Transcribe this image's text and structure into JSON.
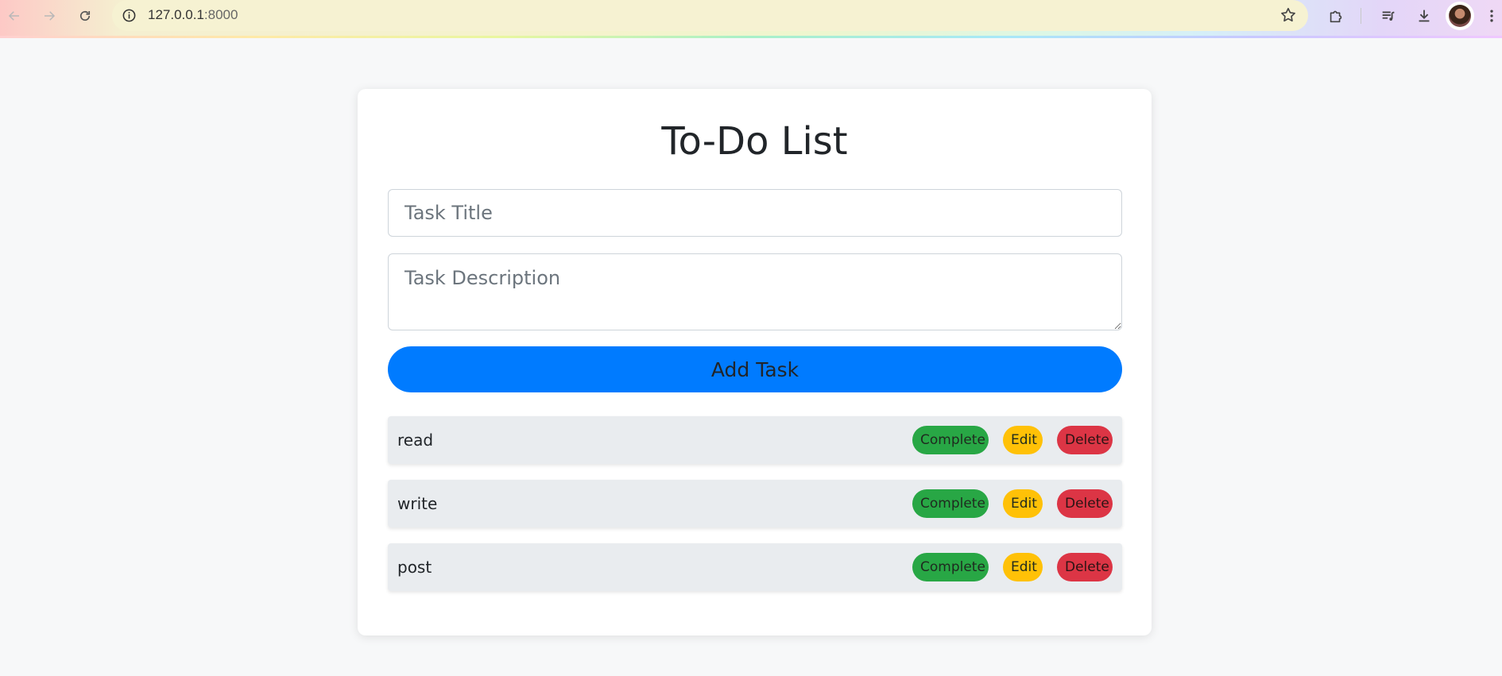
{
  "browser": {
    "url_host": "127.0.0.1",
    "url_port": ":8000"
  },
  "page": {
    "title": "To-Do List",
    "title_placeholder": "Task Title",
    "description_placeholder": "Task Description",
    "add_button_label": "Add Task"
  },
  "tasks": [
    {
      "title": "read",
      "complete_label": "Complete",
      "edit_label": "Edit",
      "delete_label": "Delete"
    },
    {
      "title": "write",
      "complete_label": "Complete",
      "edit_label": "Edit",
      "delete_label": "Delete"
    },
    {
      "title": "post",
      "complete_label": "Complete",
      "edit_label": "Edit",
      "delete_label": "Delete"
    }
  ],
  "colors": {
    "primary": "#007bff",
    "complete": "#28a745",
    "edit": "#ffc107",
    "delete": "#dc3545",
    "task_bg": "#e9ecef",
    "page_bg": "#f7f8f9"
  },
  "icons": {
    "back": "arrow-left-icon",
    "forward": "arrow-right-icon",
    "reload": "reload-icon",
    "site_info": "info-icon",
    "bookmark": "star-icon",
    "extensions": "puzzle-icon",
    "media": "media-queue-icon",
    "downloads": "download-icon",
    "menu": "kebab-menu-icon"
  }
}
